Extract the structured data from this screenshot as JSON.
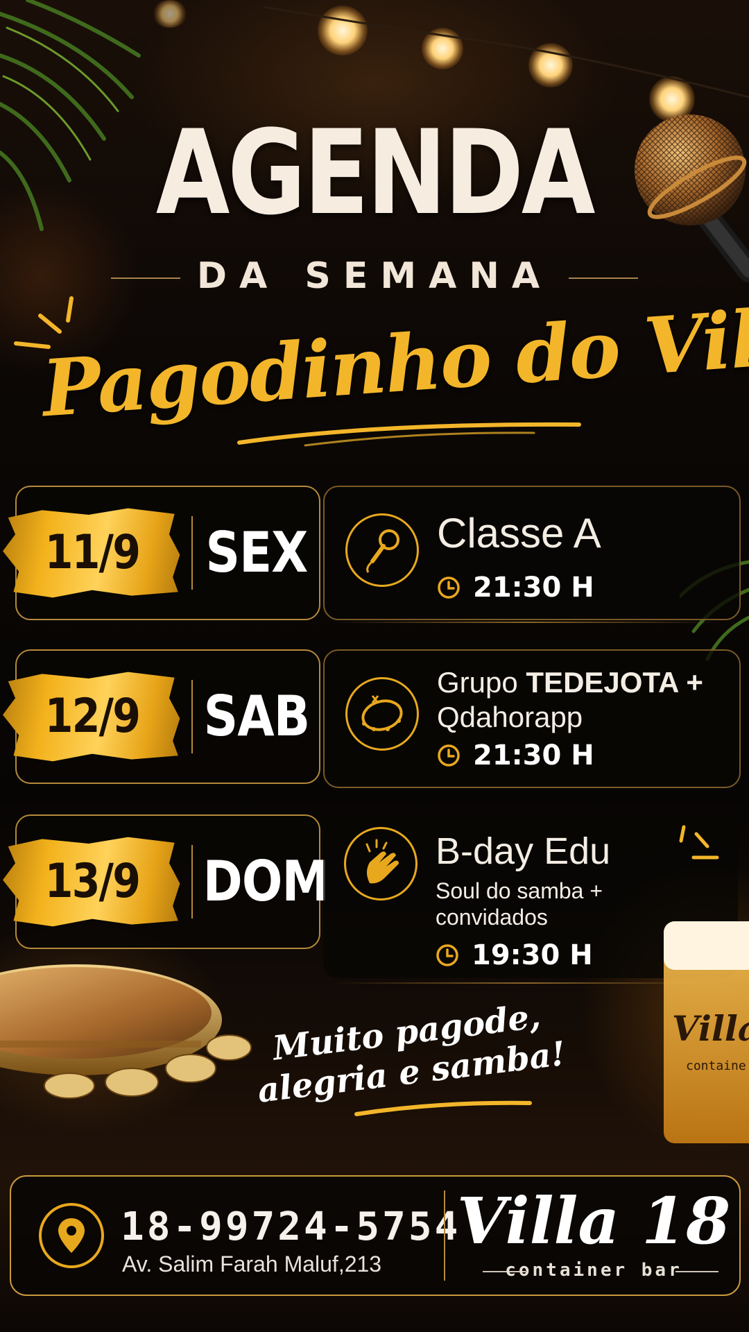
{
  "header": {
    "title": "AGENDA",
    "subtitle": "DA SEMANA",
    "event_name": "Pagodinho do Villa"
  },
  "schedule": [
    {
      "date": "11/9",
      "day": "SEX",
      "icon": "microphone-icon",
      "title": "Classe A",
      "time": "21:30 H"
    },
    {
      "date": "12/9",
      "day": "SAB",
      "icon": "tambourine-icon",
      "title_prefix": "Grupo ",
      "title_bold": "TEDEJOTA +",
      "title_line2": "Qdahorapp",
      "time": "21:30 H"
    },
    {
      "date": "13/9",
      "day": "DOM",
      "icon": "clapping-hands-icon",
      "title": "B-day Edu",
      "subtitle_line1": "Soul do samba +",
      "subtitle_line2": "convidados",
      "time": "19:30 H"
    }
  ],
  "tagline": {
    "line1": "Muito pagode,",
    "line2": "alegria e samba!"
  },
  "footer": {
    "phone": "18-99724-5754",
    "address": "Av. Salim Farah Maluf,213",
    "brand_name": "Villa 18",
    "brand_tag": "container bar",
    "icon": "location-pin-icon"
  },
  "decor": {
    "glass_logo": "Villa",
    "glass_logo_sub": "containe"
  },
  "colors": {
    "accent": "#f3b62a",
    "background": "#0a0604",
    "text": "#f6ece0"
  }
}
